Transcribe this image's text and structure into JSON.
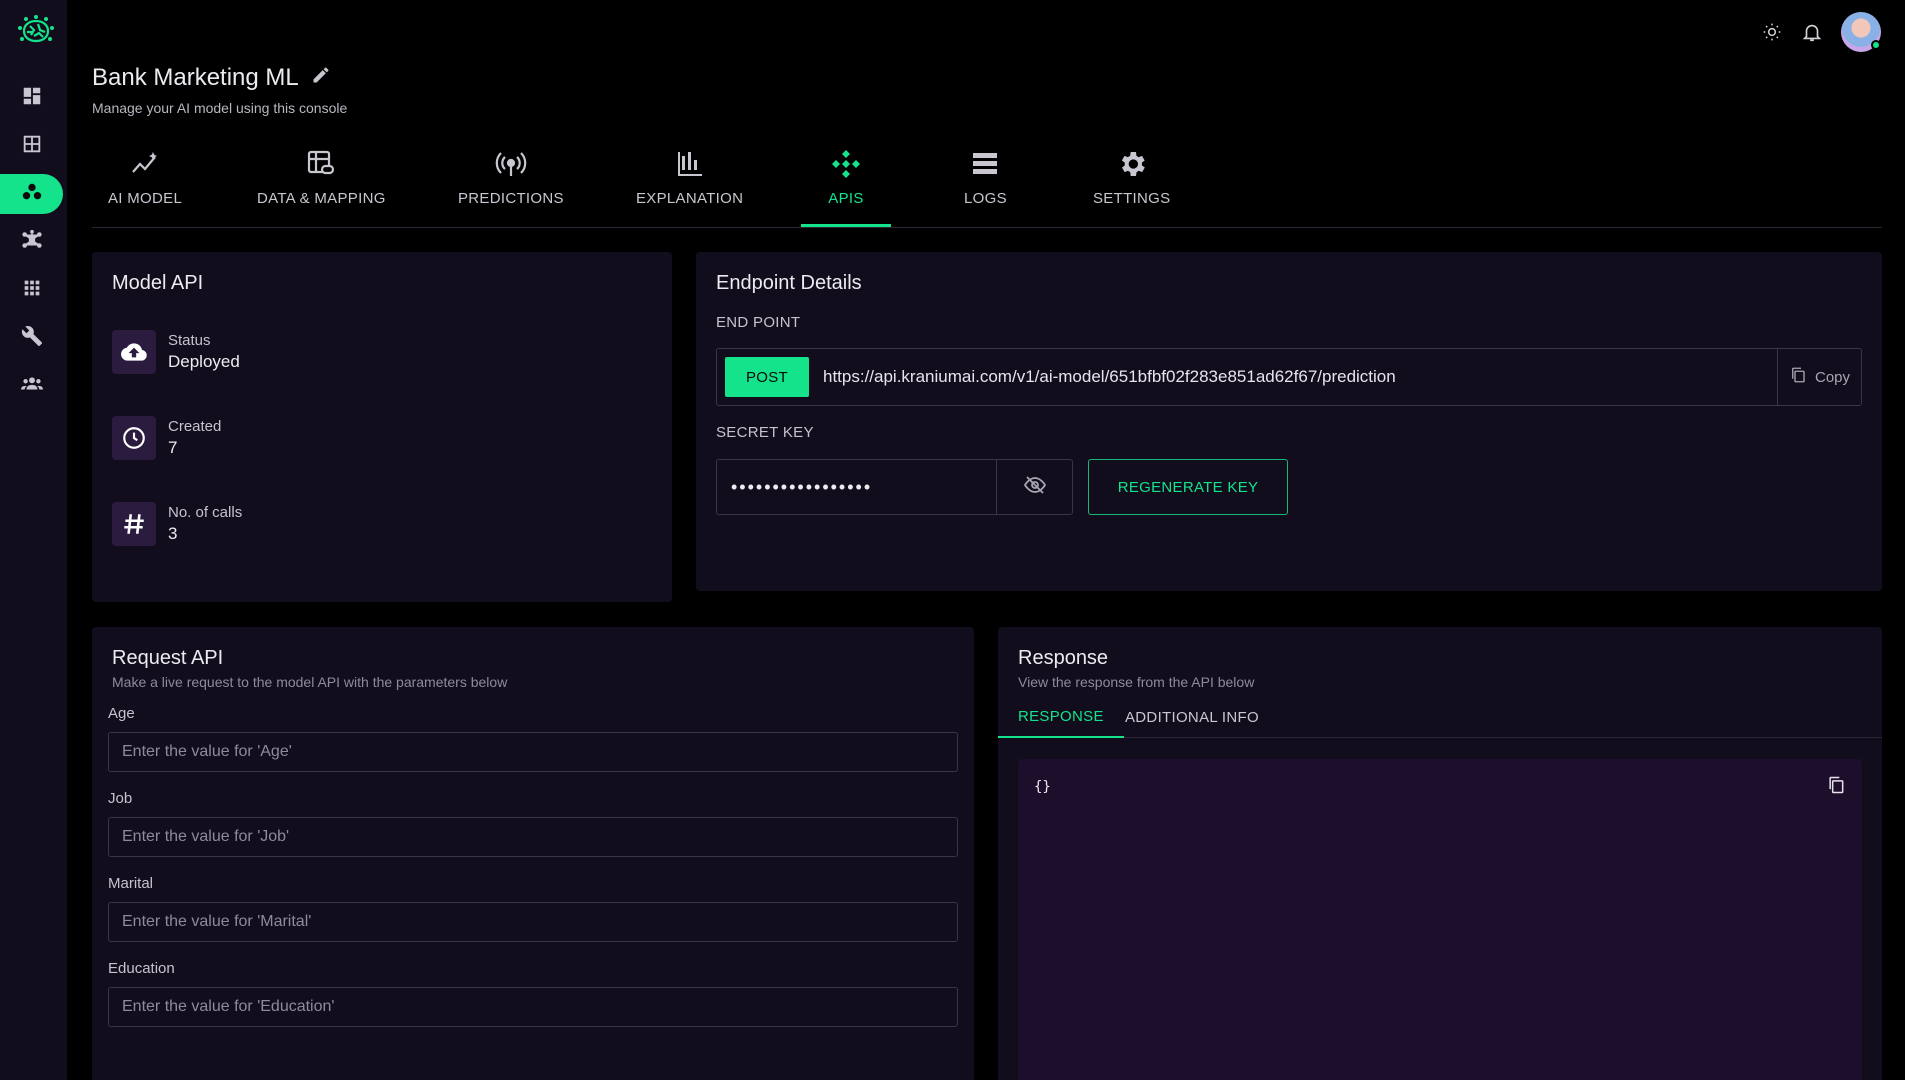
{
  "header": {
    "title": "Bank Marketing ML",
    "subtitle": "Manage your AI model using this console"
  },
  "sidebar": {
    "items": [
      {
        "icon": "dashboard-icon"
      },
      {
        "icon": "grid-icon"
      },
      {
        "icon": "models-icon",
        "active": true
      },
      {
        "icon": "network-icon"
      },
      {
        "icon": "apps-icon"
      },
      {
        "icon": "wrench-icon"
      },
      {
        "icon": "team-icon"
      }
    ]
  },
  "tabs": [
    {
      "label": "AI MODEL",
      "icon": "ai-model-icon"
    },
    {
      "label": "DATA & MAPPING",
      "icon": "data-mapping-icon"
    },
    {
      "label": "PREDICTIONS",
      "icon": "predictions-icon"
    },
    {
      "label": "EXPLANATION",
      "icon": "explanation-icon"
    },
    {
      "label": "APIS",
      "icon": "apis-icon",
      "active": true
    },
    {
      "label": "LOGS",
      "icon": "logs-icon"
    },
    {
      "label": "SETTINGS",
      "icon": "settings-icon"
    }
  ],
  "model_api": {
    "title": "Model API",
    "stats": [
      {
        "label": "Status",
        "value": "Deployed",
        "icon": "cloud-upload-icon"
      },
      {
        "label": "Created",
        "value": "7",
        "icon": "clock-icon"
      },
      {
        "label": "No. of calls",
        "value": "3",
        "icon": "hash-icon"
      }
    ]
  },
  "endpoint": {
    "title": "Endpoint Details",
    "endpoint_label": "END POINT",
    "method": "POST",
    "url": "https://api.kraniumai.com/v1/ai-model/651bfbf02f283e851ad62f67/prediction",
    "copy_label": "Copy",
    "secret_label": "SECRET KEY",
    "secret_value": "•••••••••••••••••",
    "regenerate_label": "REGENERATE KEY"
  },
  "request": {
    "title": "Request API",
    "subtitle": "Make a live request to the model API with the parameters below",
    "fields": [
      {
        "label": "Age",
        "placeholder": "Enter the value for 'Age'"
      },
      {
        "label": "Job",
        "placeholder": "Enter the value for 'Job'"
      },
      {
        "label": "Marital",
        "placeholder": "Enter the value for 'Marital'"
      },
      {
        "label": "Education",
        "placeholder": "Enter the value for 'Education'"
      }
    ]
  },
  "response": {
    "title": "Response",
    "subtitle": "View the response from the API below",
    "tabs": [
      {
        "label": "RESPONSE",
        "active": true
      },
      {
        "label": "ADDITIONAL INFO"
      }
    ],
    "body": "{}"
  },
  "colors": {
    "accent": "#14e38b",
    "card_bg": "#120d1c",
    "response_bg": "#1d0e2b"
  }
}
